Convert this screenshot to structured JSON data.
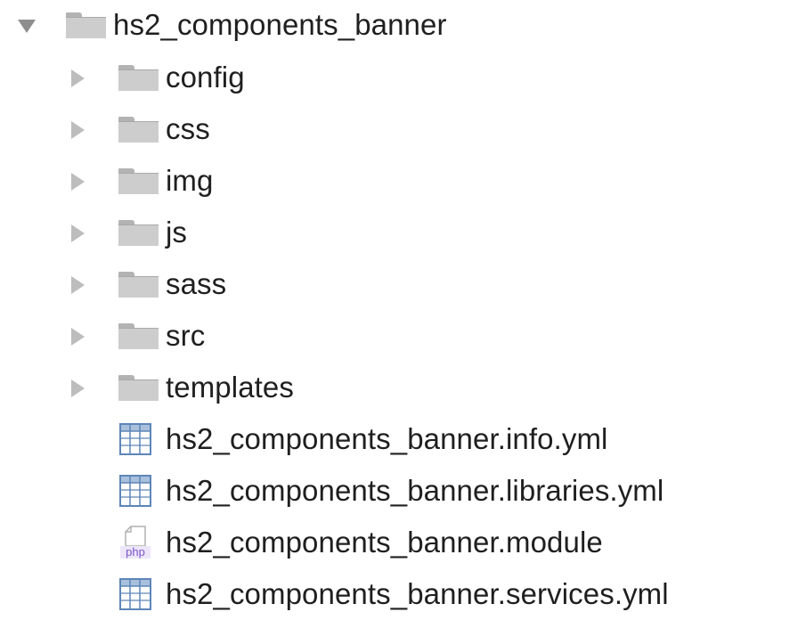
{
  "tree": {
    "root": {
      "label": "hs2_components_banner",
      "icon": "folder-icon",
      "expanded": true
    },
    "folders": [
      {
        "label": "config",
        "icon": "folder-icon",
        "expanded": false
      },
      {
        "label": "css",
        "icon": "folder-icon",
        "expanded": false
      },
      {
        "label": "img",
        "icon": "folder-icon",
        "expanded": false
      },
      {
        "label": "js",
        "icon": "folder-icon",
        "expanded": false
      },
      {
        "label": "sass",
        "icon": "folder-icon",
        "expanded": false
      },
      {
        "label": "src",
        "icon": "folder-icon",
        "expanded": false
      },
      {
        "label": "templates",
        "icon": "folder-icon",
        "expanded": false
      }
    ],
    "files": [
      {
        "label": "hs2_components_banner.info.yml",
        "icon": "yml-file-icon"
      },
      {
        "label": "hs2_components_banner.libraries.yml",
        "icon": "yml-file-icon"
      },
      {
        "label": "hs2_components_banner.module",
        "icon": "php-file-icon",
        "badge": "php"
      },
      {
        "label": "hs2_components_banner.services.yml",
        "icon": "yml-file-icon"
      }
    ]
  },
  "colors": {
    "text": "#1f1f1f",
    "folder": "#cdcdcd",
    "disclosure": "#bdbdbd",
    "php_badge": "#7b55c9",
    "yml_grid": "#5d86b8"
  }
}
